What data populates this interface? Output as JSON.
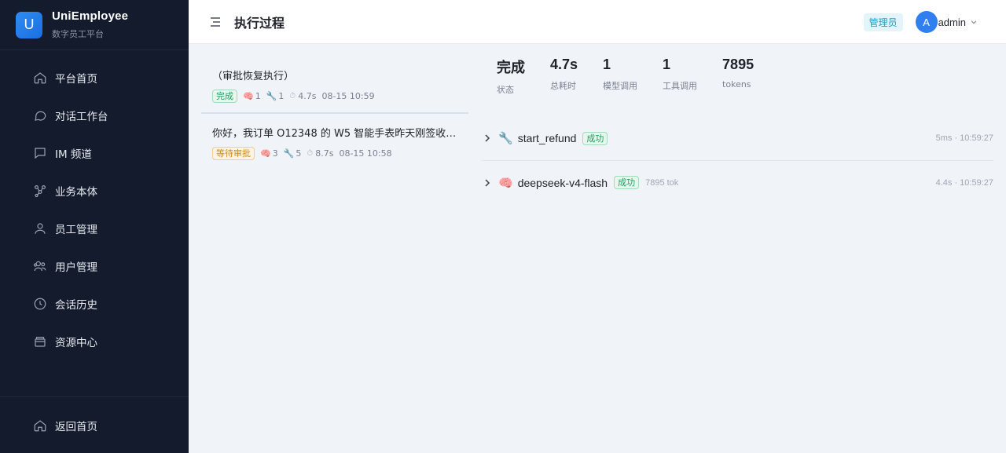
{
  "brand": {
    "logo_letter": "U",
    "name": "UniEmployee",
    "subtitle": "数字员工平台"
  },
  "sidebar": {
    "items": [
      {
        "label": "平台首页",
        "icon": "home-icon"
      },
      {
        "label": "对话工作台",
        "icon": "chat-icon"
      },
      {
        "label": "IM 频道",
        "icon": "message-square-icon"
      },
      {
        "label": "业务本体",
        "icon": "graph-icon"
      },
      {
        "label": "员工管理",
        "icon": "user-icon"
      },
      {
        "label": "用户管理",
        "icon": "users-icon"
      },
      {
        "label": "会话历史",
        "icon": "clock-icon"
      },
      {
        "label": "资源中心",
        "icon": "box-icon"
      }
    ],
    "bottom": {
      "label": "返回首页",
      "icon": "home-icon"
    }
  },
  "header": {
    "title": "执行过程",
    "role_badge": "管理员",
    "avatar_letter": "A",
    "username": "admin"
  },
  "runs": [
    {
      "title": "（审批恢复执行）",
      "status": "完成",
      "model_calls": "1",
      "tool_calls": "1",
      "duration": "4.7s",
      "time": "08-15 10:59"
    },
    {
      "title": "你好，我订单 O12348 的 W5 智能手表昨天刚签收…",
      "status": "等待审批",
      "model_calls": "3",
      "tool_calls": "5",
      "duration": "8.7s",
      "time": "08-15 10:58"
    }
  ],
  "stats": [
    {
      "value": "完成",
      "label": "状态"
    },
    {
      "value": "4.7s",
      "label": "总耗时"
    },
    {
      "value": "1",
      "label": "模型调用"
    },
    {
      "value": "1",
      "label": "工具调用"
    },
    {
      "value": "7895",
      "label": "tokens"
    }
  ],
  "steps": [
    {
      "icon": "wrench-icon",
      "glyph": "🔧",
      "name": "start_refund",
      "status": "成功",
      "tokens": "",
      "time": "5ms · 10:59:27"
    },
    {
      "icon": "brain-icon",
      "glyph": "🧠",
      "name": "deepseek-v4-flash",
      "status": "成功",
      "tokens": "7895 tok",
      "time": "4.4s · 10:59:27"
    }
  ],
  "colors": {
    "sidebar_bg": "#131b2c",
    "accent": "#2f7ff0",
    "success": "#1f9d63",
    "pending": "#d68a10"
  }
}
